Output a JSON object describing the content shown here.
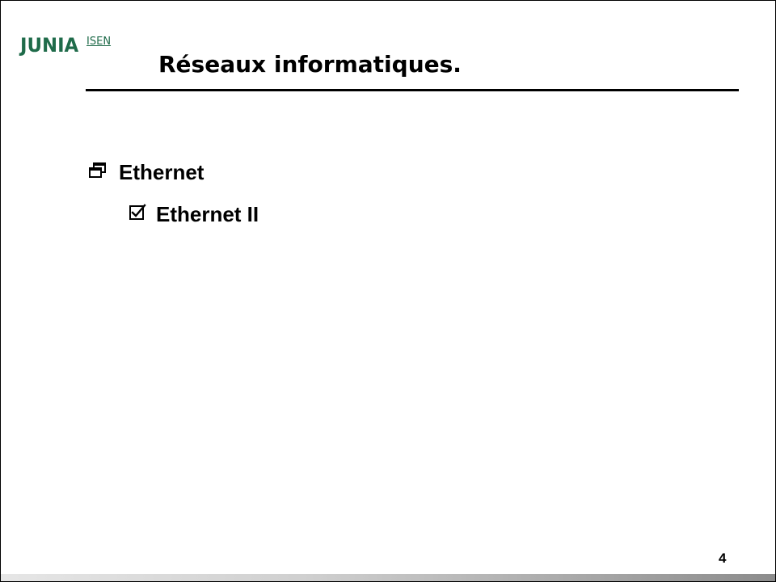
{
  "logo": {
    "word": "JUNIA",
    "sub": "ISEN"
  },
  "slide": {
    "title": "Réseaux informatiques.",
    "bullets": [
      {
        "icon": "windows-restore-icon",
        "text": "Ethernet"
      },
      {
        "icon": "checked-box-icon",
        "text": "Ethernet II"
      }
    ],
    "page_number": "4"
  },
  "colors": {
    "brand": "#1f6b4a",
    "text": "#000000",
    "background": "#ffffff"
  }
}
